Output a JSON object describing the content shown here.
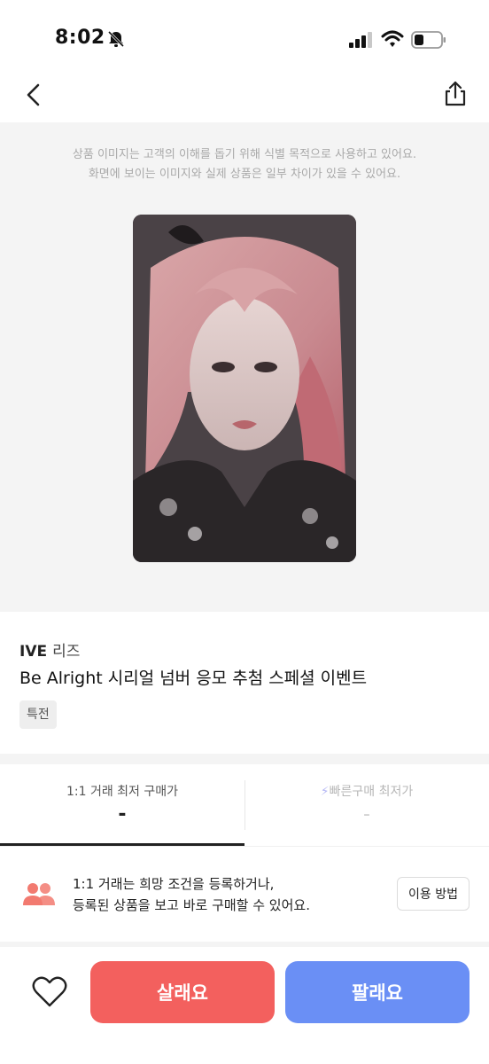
{
  "status_bar": {
    "time": "8:02",
    "icons": [
      "bell-slash-icon",
      "signal-icon",
      "wifi-icon",
      "battery-icon"
    ]
  },
  "nav": {
    "back_icon": "chevron-left-icon",
    "share_icon": "share-icon"
  },
  "image_area": {
    "notice_line1": "상품 이미지는 고객의 이해를 돕기 위해 식별 목적으로 사용하고 있어요.",
    "notice_line2": "화면에 보이는 이미지와 실제 상품은 일부 차이가 있을 수 있어요."
  },
  "product": {
    "group": "IVE",
    "member": "리즈",
    "title": "Be Alright 시리얼 넘버 응모 추첨 스페셜 이벤트",
    "tag": "특전"
  },
  "price_tabs": [
    {
      "label": "1:1 거래 최저 구매가",
      "value": "-"
    },
    {
      "label": "빠른구매 최저가",
      "value": "-"
    }
  ],
  "info": {
    "line1": "1:1 거래는 희망 조건을 등록하거나,",
    "line2": "등록된 상품을 보고 바로 구매할 수 있어요.",
    "button_label": "이용 방법"
  },
  "bottom_bar": {
    "buy_label": "살래요",
    "sell_label": "팔래요"
  },
  "colors": {
    "buy": "#f3605e",
    "sell": "#6a8ff5",
    "accent_people": "#f27a70"
  }
}
